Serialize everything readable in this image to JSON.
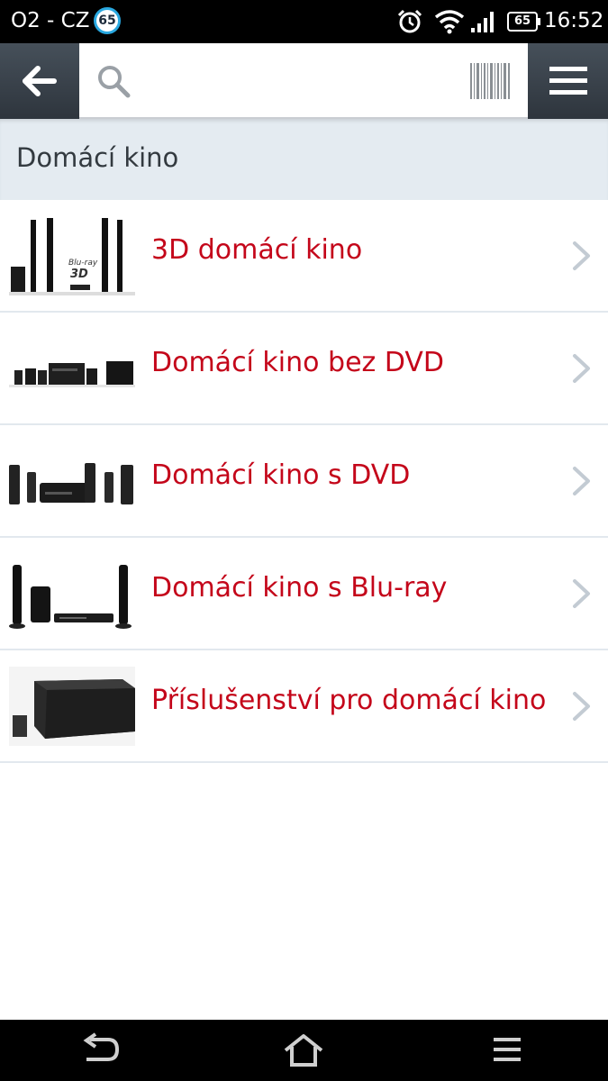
{
  "status_bar": {
    "carrier": "O2 - CZ",
    "notification_count": "65",
    "battery_level": "65",
    "time": "16:52"
  },
  "toolbar": {
    "back_icon": "arrow-left-icon",
    "search": {
      "value": "",
      "placeholder": ""
    },
    "search_icon": "search-icon",
    "barcode_icon": "barcode-icon",
    "menu_icon": "hamburger-icon"
  },
  "section": {
    "title": "Domácí kino"
  },
  "categories": [
    {
      "label": "3D domácí kino",
      "image": "3d-home-theater-thumbnail"
    },
    {
      "label": "Domácí kino bez DVD",
      "image": "home-theater-no-dvd-thumbnail"
    },
    {
      "label": "Domácí kino s DVD",
      "image": "home-theater-dvd-thumbnail"
    },
    {
      "label": "Domácí kino s Blu-ray",
      "image": "home-theater-bluray-thumbnail"
    },
    {
      "label": "Příslušenství pro domácí kino",
      "image": "accessories-thumbnail"
    }
  ],
  "thumbnail_text": {
    "bluray_logo": "Blu-ray",
    "logo_3d": "3D"
  },
  "nav_bar": {
    "back_icon": "nav-back-icon",
    "home_icon": "nav-home-icon",
    "menu_icon": "nav-menu-icon"
  },
  "colors": {
    "accent_red": "#c4061a",
    "toolbar": "#3a424a",
    "header_bg": "#e4ebf1"
  }
}
